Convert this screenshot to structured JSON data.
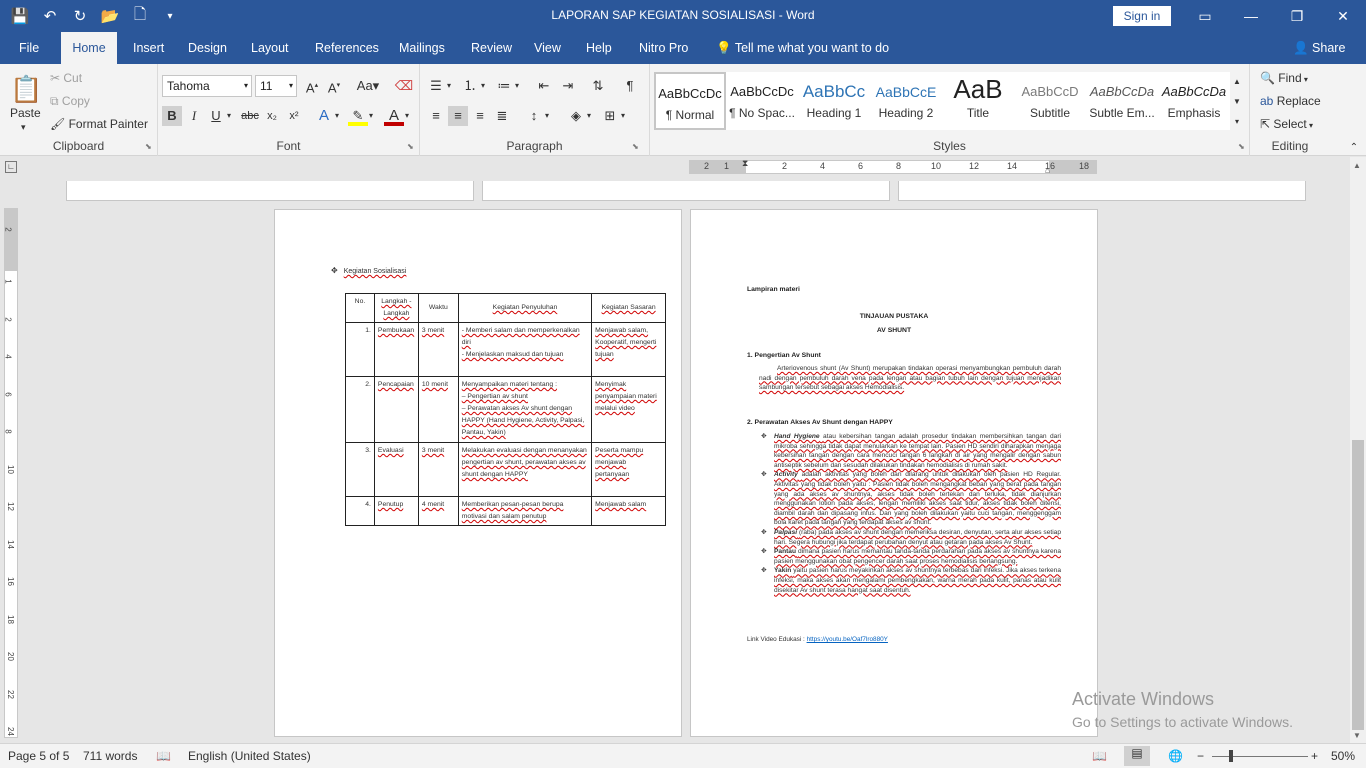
{
  "title_bar": {
    "document_title": "LAPORAN SAP KEGIATAN SOSIALISASI  -  Word",
    "sign_in": "Sign in"
  },
  "menu_tabs": [
    "File",
    "Home",
    "Insert",
    "Design",
    "Layout",
    "References",
    "Mailings",
    "Review",
    "View",
    "Help",
    "Nitro Pro"
  ],
  "active_tab": "Home",
  "tell_me": "Tell me what you want to do",
  "share": "Share",
  "ribbon": {
    "clipboard": {
      "paste": "Paste",
      "cut": "Cut",
      "copy": "Copy",
      "format_painter": "Format Painter",
      "label": "Clipboard"
    },
    "font": {
      "name": "Tahoma",
      "size": "11",
      "label": "Font"
    },
    "paragraph": {
      "label": "Paragraph"
    },
    "styles": {
      "label": "Styles",
      "items": [
        {
          "preview": "AaBbCcDc",
          "name": "¶ Normal"
        },
        {
          "preview": "AaBbCcDc",
          "name": "¶ No Spac..."
        },
        {
          "preview": "AaBbCc",
          "name": "Heading 1"
        },
        {
          "preview": "AaBbCcE",
          "name": "Heading 2"
        },
        {
          "preview": "AaB",
          "name": "Title"
        },
        {
          "preview": "AaBbCcD",
          "name": "Subtitle"
        },
        {
          "preview": "AaBbCcDa",
          "name": "Subtle Em..."
        },
        {
          "preview": "AaBbCcDa",
          "name": "Emphasis"
        }
      ]
    },
    "editing": {
      "find": "Find",
      "replace": "Replace",
      "select": "Select",
      "label": "Editing"
    }
  },
  "ruler_ticks": [
    "2",
    "1",
    "1",
    "2",
    "4",
    "6",
    "8",
    "10",
    "12",
    "14",
    "16",
    "18"
  ],
  "vruler_ticks": [
    "2",
    "1",
    "2",
    "4",
    "6",
    "8",
    "10",
    "12",
    "14",
    "16",
    "18",
    "20",
    "22",
    "24"
  ],
  "page1": {
    "heading": "Kegiatan Sosialisasi",
    "columns": [
      "No.",
      "Langkah - Langkah",
      "Waktu",
      "Kegiatan Penyuluhan",
      "Kegiatan Sasaran"
    ],
    "rows": [
      {
        "no": "1.",
        "step": "Pembukaan",
        "time": "3 menit",
        "activity": [
          "- Memberi salam dan memperkenalkan diri",
          "- Menjelaskan maksud dan tujuan"
        ],
        "target": "Menjawab salam, Kooperatif, mengerti tujuan"
      },
      {
        "no": "2.",
        "step": "Pencapaian",
        "time": "10 menit",
        "activity": [
          "Menyampaikan materi tentang :",
          "– Pengertian av shunt",
          "– Perawatan akses Av shunt dengan HAPPY (Hand Hygiene, Activity, Palpasi, Pantau, Yakin)"
        ],
        "target": "Menyimak penyampaian materi melalui video"
      },
      {
        "no": "3.",
        "step": "Evaluasi",
        "time": "3 menit",
        "activity": [
          "Melakukan evaluasi dengan menanyakan pengertian av shunt, perawatan akses av shunt dengan HAPPY"
        ],
        "target": "Peserta mampu menjawab pertanyaan"
      },
      {
        "no": "4.",
        "step": "Penutup",
        "time": "4 menit",
        "activity": [
          "Memberikan pesan-pesan berupa motivasi dan salam penutup"
        ],
        "target": "Menjawab salam"
      }
    ]
  },
  "page2": {
    "lampiran": "Lampiran materi",
    "title1": "TINJAUAN PUSTAKA",
    "title2": "AV SHUNT",
    "sec1_title": "1.  Pengertian Av Shunt",
    "sec1_text": "Arteriovenous shunt (Av Shunt) merupakan tindakan operasi menyambungkan pembuluh darah nadi dengan pembuluh darah vena pada lengan atau bagian tubuh lain dengan tujuan menjadikan sambungan tersebut sebagai akses Hemodialisis.",
    "sec2_title": "2.  Perawatan Akses Av Shunt dengan HAPPY",
    "bullets": [
      {
        "lead": "Hand Hygiene",
        "text": "atau kebersihan tangan adalah prosedur tindakan membersihkan tangan dari mikroba sehingga tidak dapat menularkan ke tempat lain. Pasien HD sendiri diharapkan menjaga kebersihan tangan dengan cara mencuci tangan 6 langkah di air yang mengalir dengan sabun antiseptik sebelum dan sesudah dilakukan tindakan hemodialisis di rumah sakit."
      },
      {
        "lead": "Activity",
        "text": "adalah aktivitas yang boleh dan dilarang untuk dilakukan oleh pasien HD Regular. Aktivitas yang tidak boleh yaitu : Pasien tidak boleh mengangkat beban yang berat pada tangan yang ada akses av shuntnya, akses tidak boleh tertekan dan terluka, tidak dianjurkan menggunakan lotion pada akses, lengan memiliki akses saat tidur, akses tidak boleh ditensi, diambil darah dan dipasang infus. Dan yang boleh dilakukan yaitu cuci tangan, menggenggam bola karet pada tangan yang terdapat akses av shunt."
      },
      {
        "lead": "Palpasi",
        "text": "(raba) pada akses av shunt dengan memeriksa desiran, denyutan, serta alur akses setiap hari. Segera hubungi jika terdapat perubahan denyut atau getaran pada akses Av Shunt."
      },
      {
        "lead": "Pantau",
        "text": "dimana pasien harus memantau tanda-tanda perdarahan pada akses av shuntnya karena pasien menggunakan obat pengencer darah saat proses hemodialisis berlangsung."
      },
      {
        "lead": "Yakin",
        "text": "yaitu pasien harus meyakinkan akses av shuntnya terbebas dari infeksi. Jika akses terkena infeksi, maka akses akan mengalami pembengkakan, warna merah pada kulit, panas atau kulit disekitar Av shunt terasa hangat saat disentuh."
      }
    ],
    "link_label": "Link Video Edukasi : ",
    "link_url": "https://youtu.be/Oaf7lro880Y"
  },
  "watermark": {
    "line1": "Activate Windows",
    "line2": "Go to Settings to activate Windows."
  },
  "status": {
    "page": "Page 5 of 5",
    "words": "711 words",
    "language": "English (United States)",
    "zoom": "50%"
  },
  "colors": {
    "brand": "#2b579a",
    "highlight": "#ffff00",
    "font_color": "#c00000",
    "link": "#0563c1"
  }
}
